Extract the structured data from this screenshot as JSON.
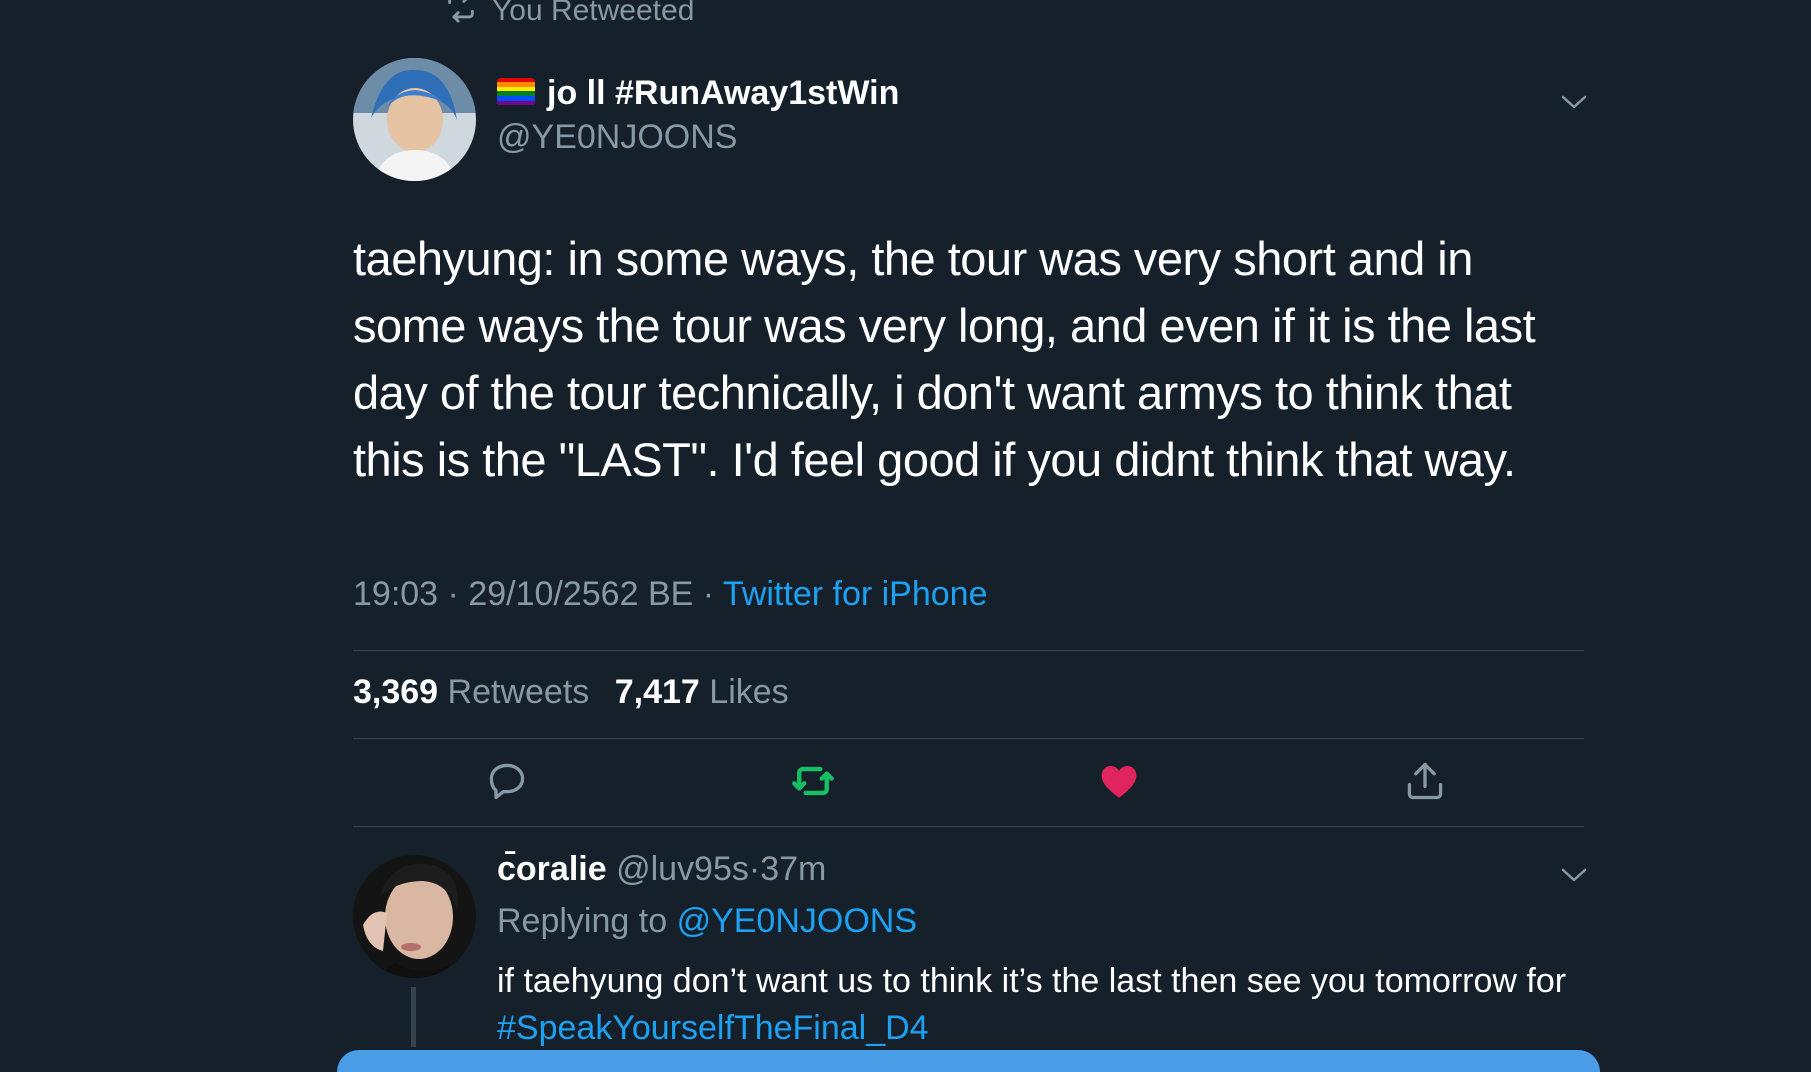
{
  "retweet_header": {
    "icon": "retweet-icon",
    "label": "You Retweeted"
  },
  "tweet": {
    "author": {
      "flag": "rainbow-flag-icon",
      "display_name": "jo ll #RunAway1stWin",
      "handle": "@YE0NJOONS"
    },
    "text": "taehyung: in some ways, the tour was very short and in some ways the tour was very long, and even if it is the last day of the tour technically, i don't want armys to think that this is the \"LAST\". I'd feel good if you didnt think that way.",
    "time": "19:03",
    "date": "29/10/2562 BE",
    "separator": "·",
    "source": "Twitter for iPhone",
    "retweets_count": "3,369",
    "retweets_label": "Retweets",
    "likes_count": "7,417",
    "likes_label": "Likes"
  },
  "actions": {
    "reply": "reply-icon",
    "retweet": "retweet-icon",
    "like": "heart-icon",
    "share": "share-icon"
  },
  "reply": {
    "display_name": "c̄oralie",
    "handle": "@luv95s",
    "separator": "·",
    "time": "37m",
    "replying_prefix": "Replying to",
    "replying_to": "@YE0NJOONS",
    "text_before": "if taehyung don’t want us to think it’s the last then see you tomorrow for",
    "hashtag": "#SpeakYourselfTheFinal_D4"
  },
  "colors": {
    "background": "#15202b",
    "muted": "#8899a6",
    "accent": "#1da1f2",
    "retweet_green": "#17bf63",
    "like_red": "#e0245e",
    "divider": "#38444d"
  }
}
